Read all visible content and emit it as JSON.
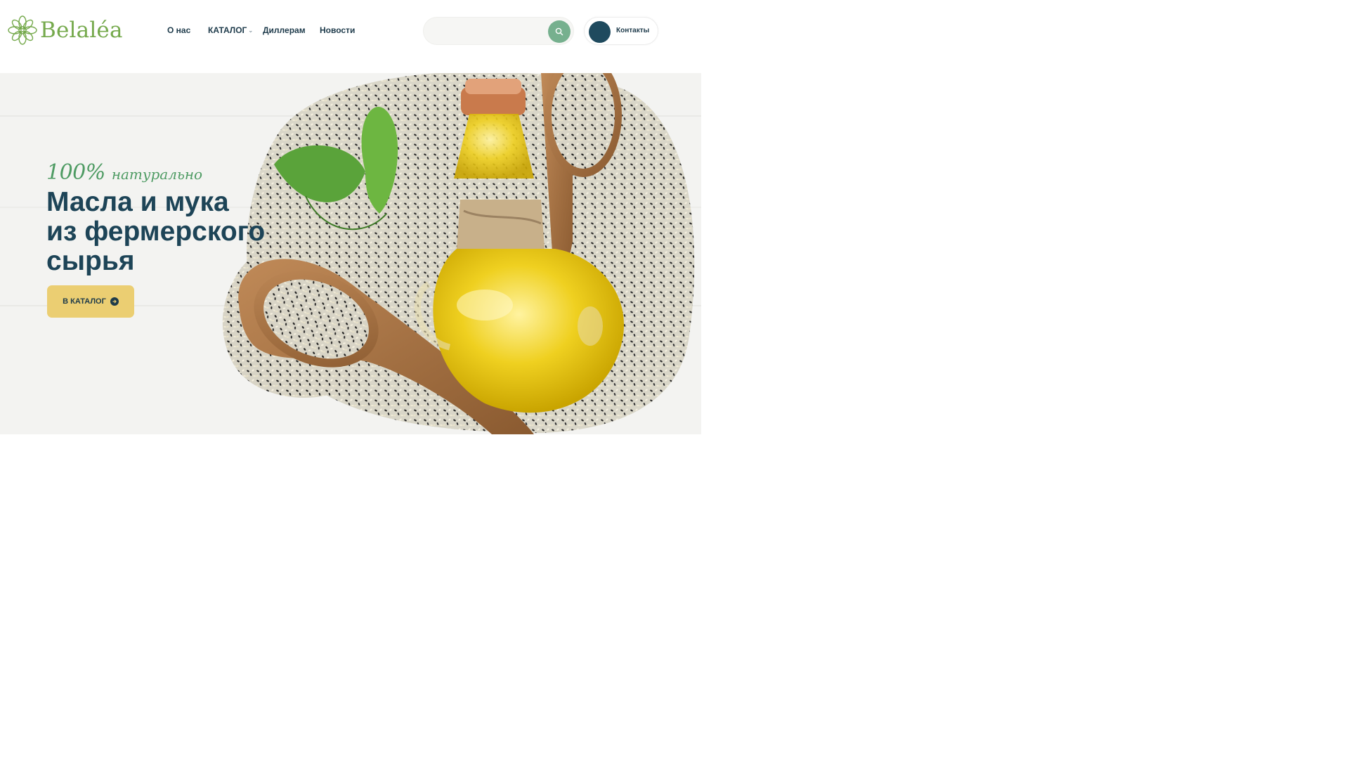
{
  "header": {
    "logo_text": "Belaléa",
    "nav": [
      {
        "label": "О нас"
      },
      {
        "label": "КАТАЛОГ",
        "has_dropdown": true
      },
      {
        "label": "Диллерам"
      },
      {
        "label": "Новости"
      }
    ],
    "search": {
      "placeholder": "",
      "value": "",
      "button_icon": "search-icon"
    },
    "contacts_label": "Контакты"
  },
  "hero": {
    "tagline_main": "100%",
    "tagline_word": "натурально",
    "title_lines": [
      "Масла и мука",
      "из фермерского",
      "сырья"
    ],
    "cta_label": "В КАТАЛОГ",
    "cta_icon": "arrow-right-circle-icon"
  },
  "colors": {
    "brand_green": "#75a94c",
    "dark_blue": "#1d4457",
    "search_button": "#76b08e",
    "contacts_dot": "#1f4a5e",
    "cta_yellow": "#ebce72"
  }
}
